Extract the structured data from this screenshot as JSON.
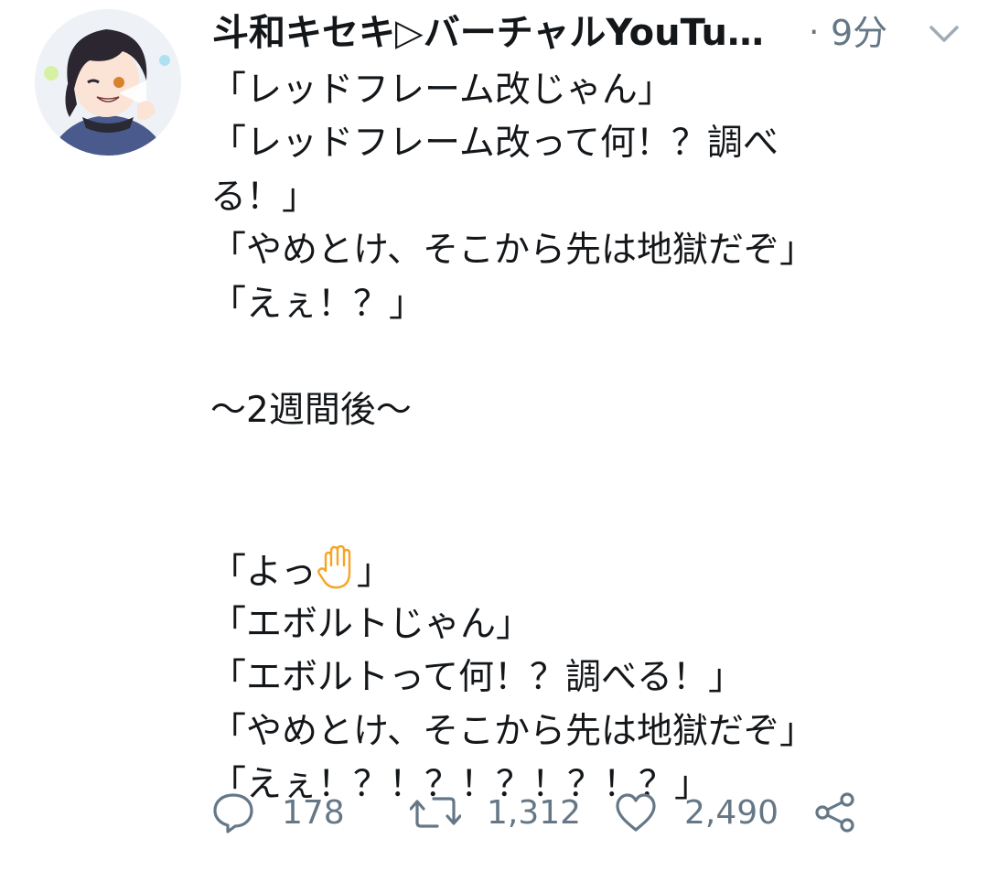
{
  "tweet": {
    "display_name": "斗和キセキ▷バーチャルYouTuber",
    "dot": "·",
    "timestamp": "9分",
    "body": {
      "lines": [
        "「レッドフレーム改じゃん」",
        "「レッドフレーム改って何！？調べ",
        "る！」",
        "「やめとけ、そこから先は地獄だぞ」",
        "「えぇ！？」",
        "",
        "〜2週間後〜",
        "",
        "",
        "「エボルトじゃん」",
        "「エボルトって何！？調べる！」",
        "「やめとけ、そこから先は地獄だぞ」",
        "「えぇ！？！？！？！？！？」"
      ],
      "yo_prefix": "「よっ",
      "yo_suffix": "」"
    },
    "actions": {
      "reply_count": "178",
      "retweet_count": "1,312",
      "like_count": "2,490"
    },
    "icons": {
      "avatar": "avatar-image",
      "caret": "chevron-down-icon",
      "hand": "raised-hand-emoji",
      "reply": "reply-icon",
      "retweet": "retweet-icon",
      "like": "heart-icon",
      "share": "share-icon"
    },
    "colors": {
      "text": "#14171a",
      "secondary": "#657786",
      "hand_emoji": "#f5a623"
    }
  }
}
